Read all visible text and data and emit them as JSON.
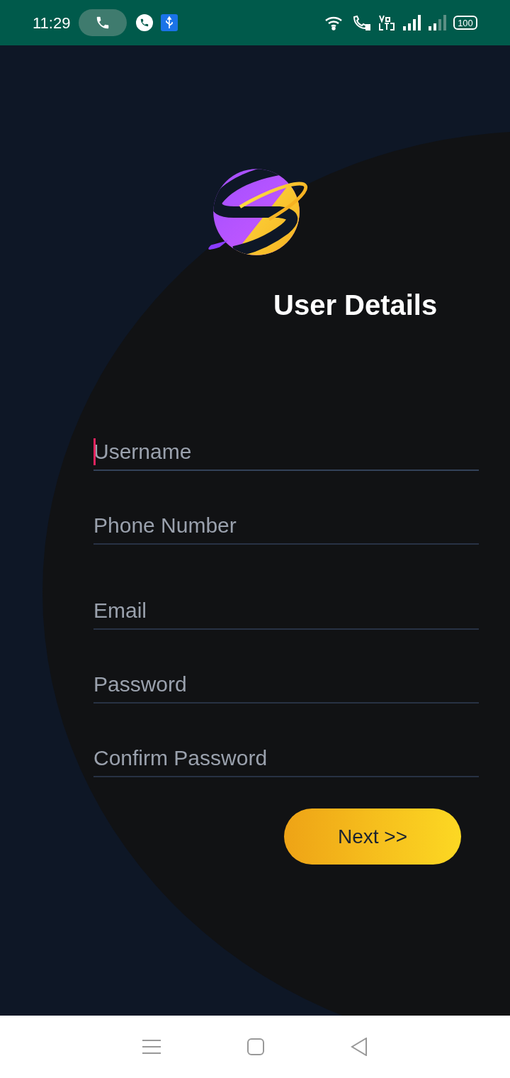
{
  "status_bar": {
    "time": "11:29",
    "battery": "100"
  },
  "title": "User Details",
  "fields": [
    {
      "placeholder": "Username",
      "focused": true
    },
    {
      "placeholder": "Phone Number",
      "focused": false
    },
    {
      "placeholder": "Email",
      "focused": false
    },
    {
      "placeholder": "Password",
      "focused": false
    },
    {
      "placeholder": "Confirm Password",
      "focused": false
    }
  ],
  "next_button": "Next >>"
}
